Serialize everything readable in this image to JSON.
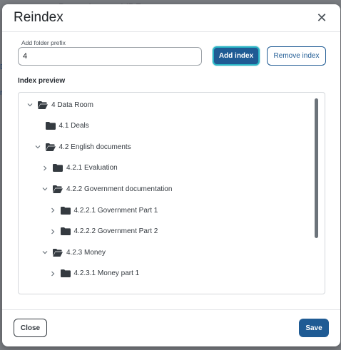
{
  "background": {
    "title": "Demo Larger VDR",
    "edge_letters": [
      "D",
      "r"
    ]
  },
  "modal": {
    "title": "Reindex",
    "close_icon": "close-icon",
    "prefix_label": "Add folder prefix",
    "prefix_value": "4",
    "add_button": "Add index",
    "remove_button": "Remove index",
    "preview_label": "Index preview",
    "tree": [
      {
        "label": "4 Data Room",
        "icon": "folder-open-icon",
        "chevron": "down",
        "depth": 0
      },
      {
        "label": "4.1 Deals",
        "icon": "folder-icon",
        "chevron": "none",
        "depth": 1
      },
      {
        "label": "4.2 English documents",
        "icon": "folder-open-icon",
        "chevron": "down",
        "depth": 1
      },
      {
        "label": "4.2.1 Evaluation",
        "icon": "folder-icon",
        "chevron": "right",
        "depth": 2
      },
      {
        "label": "4.2.2 Government documentation",
        "icon": "folder-open-icon",
        "chevron": "down",
        "depth": 2
      },
      {
        "label": "4.2.2.1 Government Part 1",
        "icon": "folder-icon",
        "chevron": "right",
        "depth": 3
      },
      {
        "label": "4.2.2.2 Government Part 2",
        "icon": "folder-icon",
        "chevron": "right",
        "depth": 3
      },
      {
        "label": "4.2.3 Money",
        "icon": "folder-open-icon",
        "chevron": "down",
        "depth": 2
      },
      {
        "label": "4.2.3.1 Money part 1",
        "icon": "folder-icon",
        "chevron": "right",
        "depth": 3
      }
    ],
    "close_button": "Close",
    "save_button": "Save"
  },
  "colors": {
    "primary": "#1f5b94",
    "focus_ring": "#2bb6c6",
    "folder": "#343a40"
  }
}
